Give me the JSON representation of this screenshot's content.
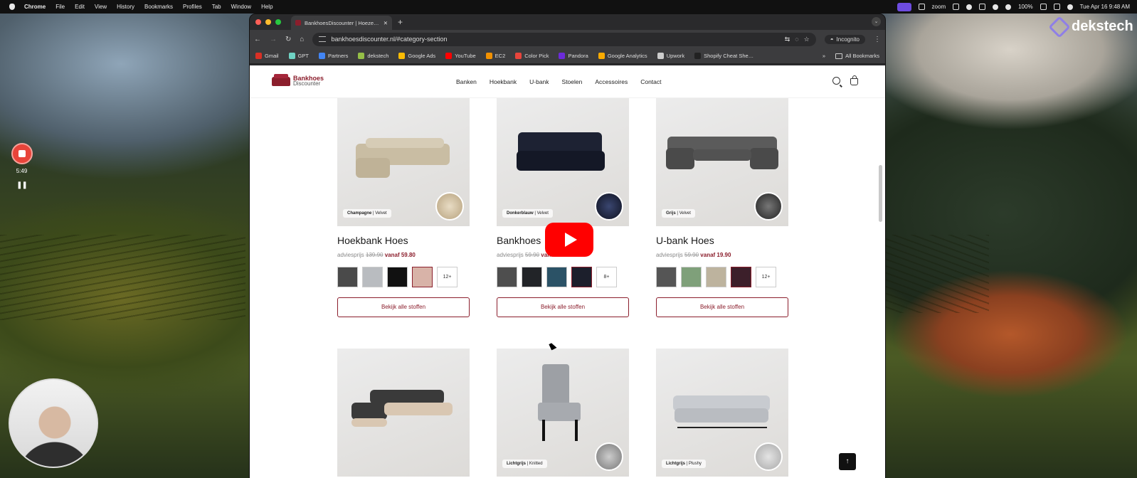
{
  "menubar": {
    "app": "Chrome",
    "items": [
      "File",
      "Edit",
      "View",
      "History",
      "Bookmarks",
      "Profiles",
      "Tab",
      "Window",
      "Help"
    ],
    "zoom": "zoom",
    "battery": "100%",
    "datetime": "Tue Apr 16  9:48 AM"
  },
  "desktop": {
    "brand": "dekstech"
  },
  "recorder": {
    "time": "5:49",
    "pause_glyph": "❚❚"
  },
  "browser": {
    "tab_title": "BankhoesDiscounter | Hoeze…",
    "url": "bankhoesdiscounter.nl/#category-section",
    "incognito_label": "Incognito",
    "bookmarks": [
      {
        "label": "Gmail",
        "color": "#d93025"
      },
      {
        "label": "GPT",
        "color": "#6fd3c4"
      },
      {
        "label": "Partners",
        "color": "#4285f4"
      },
      {
        "label": "dekstech",
        "color": "#95bf47"
      },
      {
        "label": "Google Ads",
        "color": "#fbbc04"
      },
      {
        "label": "YouTube",
        "color": "#ff0000"
      },
      {
        "label": "EC2",
        "color": "#f29100"
      },
      {
        "label": "Color Pick",
        "color": "#e8453c"
      },
      {
        "label": "Pandora",
        "color": "#6c2bd9"
      },
      {
        "label": "Google Analytics",
        "color": "#f9ab00"
      },
      {
        "label": "Upwork",
        "color": "#cccccc"
      },
      {
        "label": "Shopify Cheat She…",
        "color": "#222222"
      }
    ],
    "more": "»",
    "all_bookmarks": "All Bookmarks"
  },
  "site": {
    "logo_line1": "Bankhoes",
    "logo_line2": "Discounter",
    "nav": [
      "Banken",
      "Hoekbank",
      "U-bank",
      "Stoelen",
      "Accessoires",
      "Contact"
    ],
    "accent": "#8b1e2c",
    "products": [
      {
        "title": "Hoekbank Hoes",
        "label_color": "Champagne",
        "label_material": "| Velvet",
        "advies": "adviesprijs",
        "old": "139.90",
        "vanaf": "vanaf 59.80",
        "more": "12+",
        "cta": "Bekijk alle stoffen",
        "swatches": [
          "#4a4a4a",
          "#b9bcc0",
          "#111111",
          "#d8b3a8"
        ]
      },
      {
        "title": "Bankhoes",
        "label_color": "Donkerblauw",
        "label_material": "| Velvet",
        "advies": "adviesprijs",
        "old": "59.90",
        "vanaf": "vanaf 19.90",
        "more": "8+",
        "cta": "Bekijk alle stoffen",
        "swatches": [
          "#4e4e4e",
          "#222428",
          "#2b5266",
          "#1c1f2c"
        ]
      },
      {
        "title": "U-bank Hoes",
        "label_color": "Grijs",
        "label_material": "| Velvet",
        "advies": "adviesprijs",
        "old": "59.90",
        "vanaf": "vanaf 19.90",
        "more": "12+",
        "cta": "Bekijk alle stoffen",
        "swatches": [
          "#555555",
          "#7fa07a",
          "#bdb39e",
          "#3c1f2a"
        ]
      },
      {
        "title": "",
        "label_color": "",
        "label_material": ""
      },
      {
        "title": "",
        "label_color": "Lichtgrijs",
        "label_material": "| Knitted"
      },
      {
        "title": "",
        "label_color": "Lichtgrijs",
        "label_material": "| Plushy"
      }
    ]
  }
}
